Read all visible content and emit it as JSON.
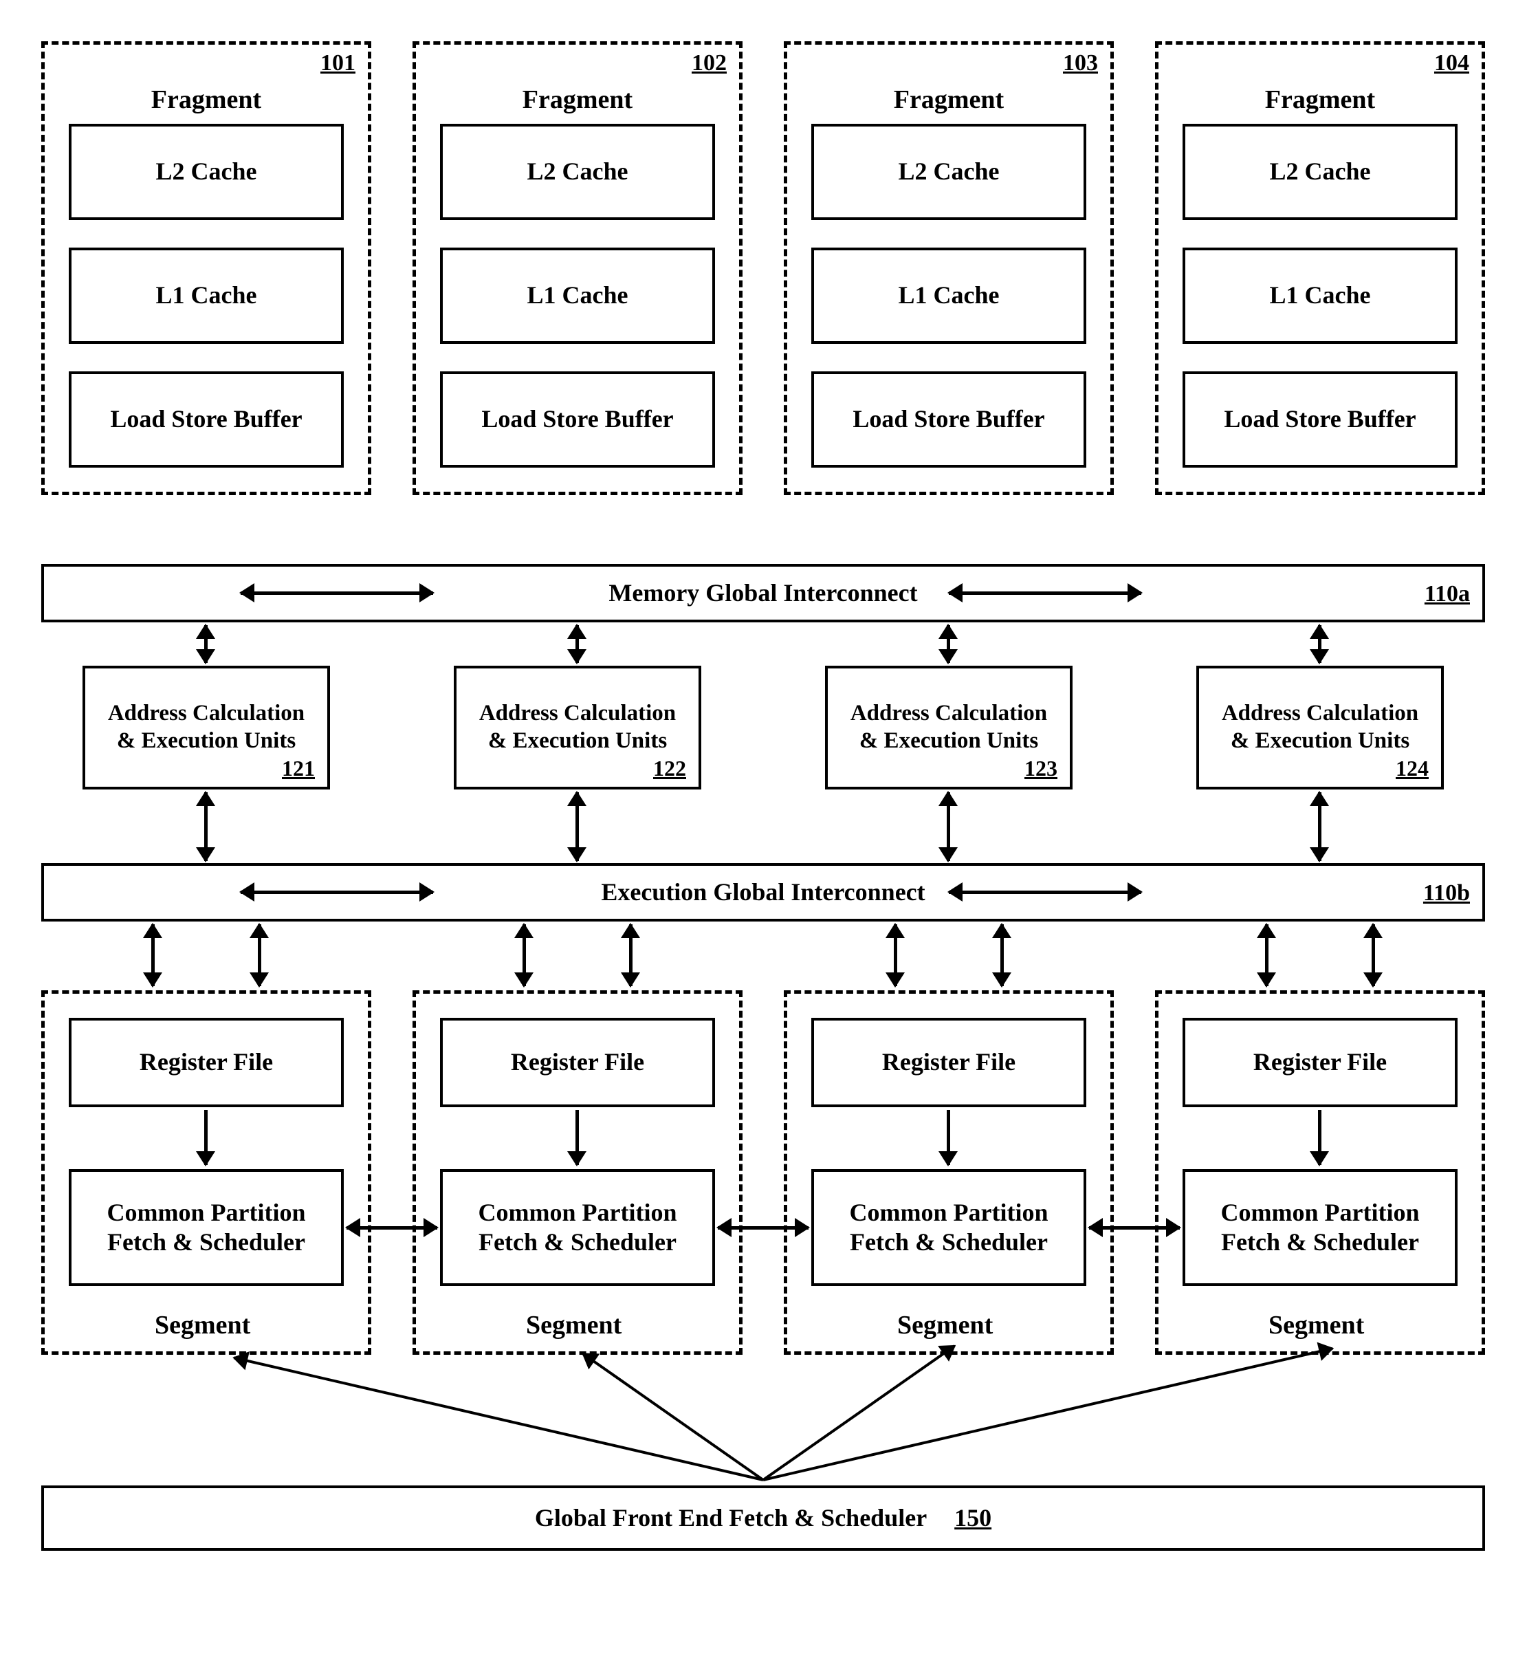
{
  "fragments": [
    {
      "ref": "101",
      "title": "Fragment",
      "l2": "L2 Cache",
      "l1": "L1 Cache",
      "lsb": "Load Store Buffer"
    },
    {
      "ref": "102",
      "title": "Fragment",
      "l2": "L2 Cache",
      "l1": "L1 Cache",
      "lsb": "Load Store Buffer"
    },
    {
      "ref": "103",
      "title": "Fragment",
      "l2": "L2 Cache",
      "l1": "L1 Cache",
      "lsb": "Load Store Buffer"
    },
    {
      "ref": "104",
      "title": "Fragment",
      "l2": "L2 Cache",
      "l1": "L1 Cache",
      "lsb": "Load Store Buffer"
    }
  ],
  "memory_interconnect": {
    "label": "Memory Global Interconnect",
    "ref": "110a"
  },
  "execution_interconnect": {
    "label": "Execution Global Interconnect",
    "ref": "110b"
  },
  "exec_units": [
    {
      "label": "Address Calculation\n& Execution Units",
      "ref": "121"
    },
    {
      "label": "Address Calculation\n& Execution Units",
      "ref": "122"
    },
    {
      "label": "Address Calculation\n& Execution Units",
      "ref": "123"
    },
    {
      "label": "Address Calculation\n& Execution Units",
      "ref": "124"
    }
  ],
  "segments": [
    {
      "rf": "Register File",
      "cp": "Common Partition\nFetch & Scheduler",
      "label": "Segment"
    },
    {
      "rf": "Register File",
      "cp": "Common Partition\nFetch & Scheduler",
      "label": "Segment"
    },
    {
      "rf": "Register File",
      "cp": "Common Partition\nFetch & Scheduler",
      "label": "Segment"
    },
    {
      "rf": "Register File",
      "cp": "Common Partition\nFetch & Scheduler",
      "label": "Segment"
    }
  ],
  "global_front_end": {
    "label": "Global Front End Fetch & Scheduler",
    "ref": "150"
  }
}
